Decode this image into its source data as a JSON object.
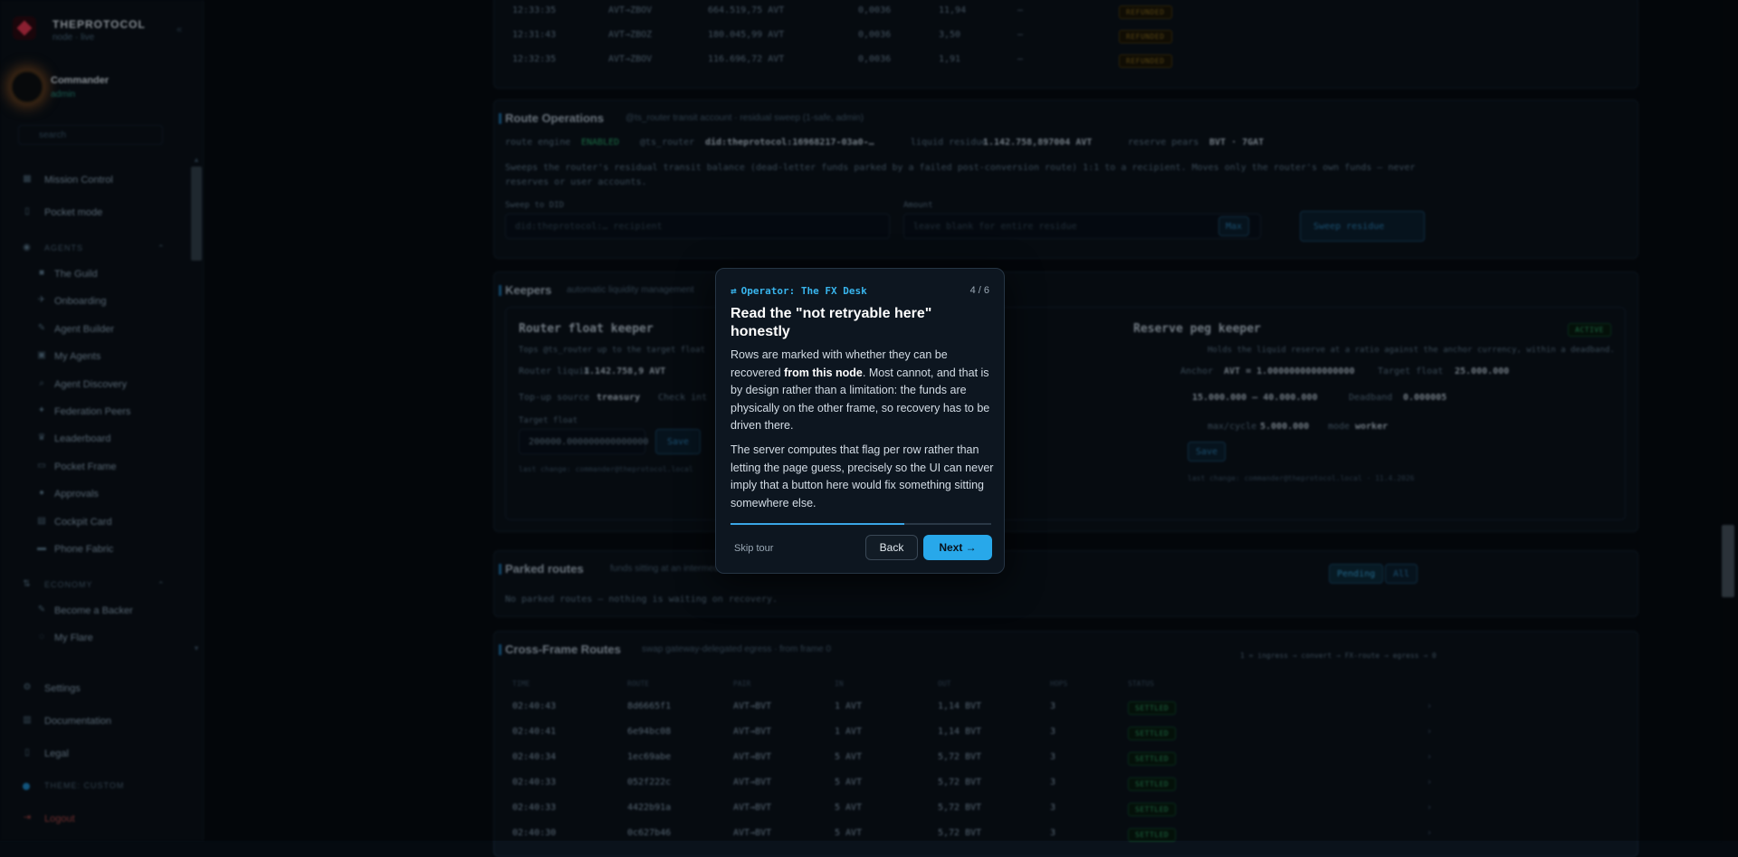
{
  "brand": {
    "name": "THEPROTOCOL",
    "sub": "node · live"
  },
  "user": {
    "name": "Commander",
    "role": "admin"
  },
  "sidebar": {
    "search_placeholder": "search",
    "items": [
      {
        "label": "Mission Control",
        "icon": "grid-icon"
      },
      {
        "label": "Pocket mode",
        "icon": "phone-icon"
      },
      {
        "label": "AGENTS",
        "icon": "agents-icon"
      },
      {
        "label": "The Guild",
        "icon": "guild-icon"
      },
      {
        "label": "Onboarding",
        "icon": "rocket-icon"
      },
      {
        "label": "Agent Builder",
        "icon": "wrench-icon"
      },
      {
        "label": "My Agents",
        "icon": "robot-icon"
      },
      {
        "label": "Agent Discovery",
        "icon": "search-icon"
      },
      {
        "label": "Federation Peers",
        "icon": "peers-icon"
      },
      {
        "label": "Leaderboard",
        "icon": "trophy-icon"
      },
      {
        "label": "Pocket Frame",
        "icon": "frame-icon"
      },
      {
        "label": "Approvals",
        "icon": "check-icon"
      },
      {
        "label": "Cockpit Card",
        "icon": "card-icon"
      },
      {
        "label": "Phone Fabric",
        "icon": "monitor-icon"
      },
      {
        "label": "ECONOMY",
        "icon": "economy-icon"
      },
      {
        "label": "Become a Backer",
        "icon": "backer-icon"
      },
      {
        "label": "My Flare",
        "icon": "flare-icon"
      },
      {
        "label": "Settings",
        "icon": "gear-icon"
      },
      {
        "label": "Documentation",
        "icon": "doc-icon"
      },
      {
        "label": "Legal",
        "icon": "legal-icon"
      },
      {
        "label": "THEME: CUSTOM",
        "icon": "theme-dot-icon"
      },
      {
        "label": "Logout",
        "icon": "logout-icon"
      }
    ]
  },
  "top_rows": [
    {
      "time": "12:33:35",
      "pair": "AVT→ZBOV",
      "amount": "664.519,75 AVT",
      "rate": "0,0036",
      "value": "11,94",
      "dash": "—",
      "status": "REFUNDED"
    },
    {
      "time": "12:31:43",
      "pair": "AVT→ZBOZ",
      "amount": "180.045,99 AVT",
      "rate": "0,0036",
      "value": "3,50",
      "dash": "—",
      "status": "REFUNDED"
    },
    {
      "time": "12:32:35",
      "pair": "AVT→ZBOV",
      "amount": "116.696,72 AVT",
      "rate": "0,0036",
      "value": "1,91",
      "dash": "—",
      "status": "REFUNDED"
    }
  ],
  "route_ops": {
    "title": "Route Operations",
    "subtitle": "@ts_router transit account · residual sweep (1-safe, admin)",
    "engine_label": "route engine",
    "engine_value": "ENABLED",
    "router_label": "@ts_router",
    "router_value": "did:theprotocol:16968217-03a0-…",
    "residue_label": "liquid residue",
    "residue_value": "1.142.758,897004 AVT",
    "reserve_label": "reserve pears",
    "reserve_value": "BVT · 7GAT",
    "desc": "Sweeps the router's residual transit balance (dead-letter funds parked by a failed post-conversion route) 1:1 to a recipient. Moves only the router's own funds — never reserves or user accounts.",
    "sweep_label": "Sweep to DID",
    "sweep_placeholder": "did:theprotocol:… recipient",
    "amount_label": "Amount",
    "amount_placeholder": "leave blank for entire residue",
    "max_label": "Max",
    "sweep_button": "Sweep residue"
  },
  "keepers": {
    "title": "Keepers",
    "subtitle": "automatic liquidity management",
    "router_keeper_title": "Router float keeper",
    "router_keeper_desc": "Tops @ts_router up to the target float",
    "router_liquid_label": "Router liquid",
    "router_liquid_value": "1.142.758,9 AVT",
    "topup_label": "Top-up source",
    "topup_value": "treasury",
    "check_label": "Check int",
    "target_label": "Target float",
    "target_value": "200000.000000000000000",
    "save_label": "Save",
    "last_change": "last change: commander@theprotocol.local",
    "peg_keeper_title": "Reserve peg keeper",
    "peg_status": "ACTIVE",
    "peg_desc": "Holds the liquid reserve at a ratio against the anchor currency, within a deadband.",
    "peg_anchor_label": "Anchor",
    "peg_anchor_value": "AVT = 1.0000000000000000",
    "peg_target_label": "Target float",
    "peg_target_value": "25.000.000",
    "peg_band_value": "15.000.000 – 40.000.000",
    "peg_deadband_label": "Deadband",
    "peg_deadband_value": "0.000005",
    "peg_cycle_label": "max/cycle",
    "peg_cycle_value": "5.000.000",
    "peg_mode_label": "mode",
    "peg_mode_value": "worker",
    "peg_save": "Save",
    "peg_last": "last change: commander@theprotocol.local · 11.4.2026"
  },
  "parked": {
    "title": "Parked routes",
    "subtitle": "funds sitting at an intermediate frame",
    "filter_pending": "Pending",
    "filter_all": "All",
    "empty": "No parked routes — nothing is waiting on recovery."
  },
  "cross_frame": {
    "title": "Cross-Frame Routes",
    "subtitle": "swap gateway-delegated egress · from frame 0",
    "legend": "1 = ingress → convert → FX-route → egress → 0",
    "headers": [
      "TIME",
      "ROUTE",
      "PAIR",
      "IN",
      "OUT",
      "HOPS",
      "STATUS"
    ],
    "rows": [
      {
        "time": "02:40:43",
        "route": "8d6665f1",
        "pair": "AVT→BVT",
        "in": "1 AVT",
        "out": "1,14 BVT",
        "hops": "3",
        "status": "SETTLED"
      },
      {
        "time": "02:40:41",
        "route": "6e94bc08",
        "pair": "AVT→BVT",
        "in": "1 AVT",
        "out": "1,14 BVT",
        "hops": "3",
        "status": "SETTLED"
      },
      {
        "time": "02:40:34",
        "route": "1ec69abe",
        "pair": "AVT→BVT",
        "in": "5 AVT",
        "out": "5,72 BVT",
        "hops": "3",
        "status": "SETTLED"
      },
      {
        "time": "02:40:33",
        "route": "052f222c",
        "pair": "AVT→BVT",
        "in": "5 AVT",
        "out": "5,72 BVT",
        "hops": "3",
        "status": "SETTLED"
      },
      {
        "time": "02:40:33",
        "route": "4422b91a",
        "pair": "AVT→BVT",
        "in": "5 AVT",
        "out": "5,72 BVT",
        "hops": "3",
        "status": "SETTLED"
      },
      {
        "time": "02:40:30",
        "route": "0c627b46",
        "pair": "AVT→BVT",
        "in": "5 AVT",
        "out": "5,72 BVT",
        "hops": "3",
        "status": "SETTLED"
      }
    ]
  },
  "tour": {
    "eyebrow": "Operator: The FX Desk",
    "eyebrow_icon": "arrows-icon",
    "step": "4 / 6",
    "progress": 0.666,
    "title": "Read the \"not retryable here\" honestly",
    "p1_a": "Rows are marked with whether they can be recovered ",
    "p1_b": "from this node",
    "p1_c": ". Most cannot, and that is by design rather than a limitation: the funds are physically on the other frame, so recovery has to be driven there.",
    "p2": "The server computes that flag per row rather than letting the page guess, precisely so the UI can never imply that a button here would fix something sitting somewhere else.",
    "skip": "Skip tour",
    "back": "Back",
    "next": "Next →"
  }
}
